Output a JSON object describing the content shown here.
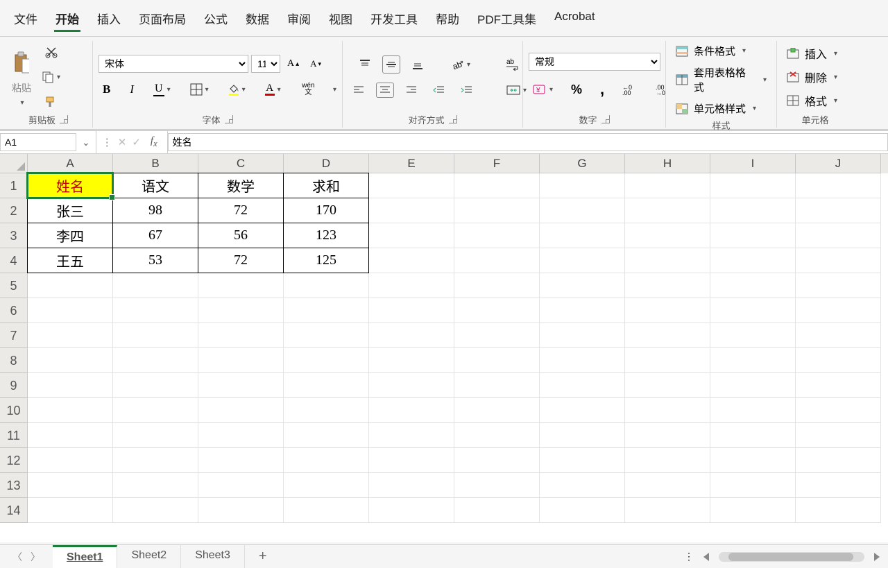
{
  "menu": {
    "items": [
      "文件",
      "开始",
      "插入",
      "页面布局",
      "公式",
      "数据",
      "审阅",
      "视图",
      "开发工具",
      "帮助",
      "PDF工具集",
      "Acrobat"
    ],
    "active": "开始"
  },
  "ribbon": {
    "clipboard": {
      "paste": "粘贴",
      "label": "剪贴板"
    },
    "font": {
      "name": "宋体",
      "size": "11",
      "bold": "B",
      "italic": "I",
      "underline": "U",
      "wenzi": "wén\n文",
      "label": "字体"
    },
    "align": {
      "label": "对齐方式"
    },
    "number": {
      "format": "常规",
      "label": "数字"
    },
    "styles": {
      "cond": "条件格式",
      "table": "套用表格格式",
      "cell": "单元格样式",
      "label": "样式"
    },
    "cells": {
      "insert": "插入",
      "delete": "删除",
      "format": "格式",
      "label": "单元格"
    }
  },
  "namebox": {
    "ref": "A1"
  },
  "formula": {
    "value": "姓名"
  },
  "grid": {
    "cols": [
      "A",
      "B",
      "C",
      "D",
      "E",
      "F",
      "G",
      "H",
      "I",
      "J"
    ],
    "rows": [
      "1",
      "2",
      "3",
      "4",
      "5",
      "6",
      "7",
      "8",
      "9",
      "10",
      "11",
      "12",
      "13",
      "14"
    ]
  },
  "chart_data": {
    "type": "table",
    "headers": [
      "姓名",
      "语文",
      "数学",
      "求和"
    ],
    "rows": [
      {
        "name": "张三",
        "c1": 98,
        "c2": 72,
        "sum": 170
      },
      {
        "name": "李四",
        "c1": 67,
        "c2": 56,
        "sum": 123
      },
      {
        "name": "王五",
        "c1": 53,
        "c2": 72,
        "sum": 125
      }
    ]
  },
  "tabs": {
    "items": [
      "Sheet1",
      "Sheet2",
      "Sheet3"
    ],
    "active": "Sheet1"
  }
}
